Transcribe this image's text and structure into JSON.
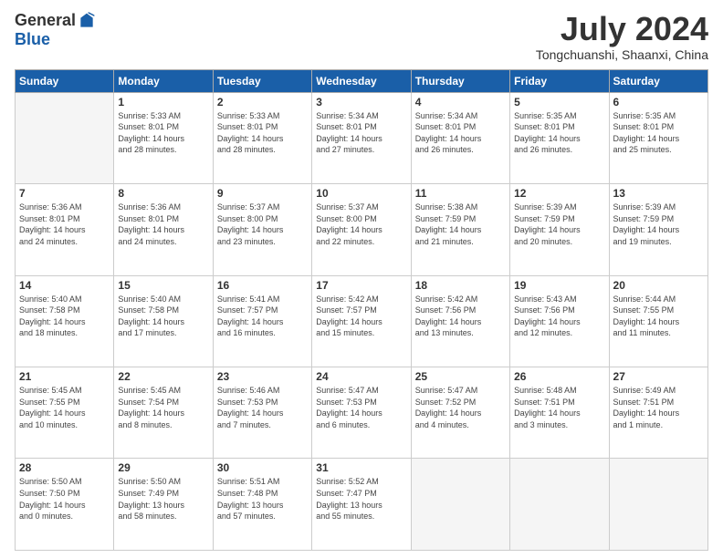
{
  "logo": {
    "general": "General",
    "blue": "Blue"
  },
  "title": "July 2024",
  "location": "Tongchuanshi, Shaanxi, China",
  "headers": [
    "Sunday",
    "Monday",
    "Tuesday",
    "Wednesday",
    "Thursday",
    "Friday",
    "Saturday"
  ],
  "weeks": [
    [
      {
        "day": "",
        "info": ""
      },
      {
        "day": "1",
        "info": "Sunrise: 5:33 AM\nSunset: 8:01 PM\nDaylight: 14 hours\nand 28 minutes."
      },
      {
        "day": "2",
        "info": "Sunrise: 5:33 AM\nSunset: 8:01 PM\nDaylight: 14 hours\nand 28 minutes."
      },
      {
        "day": "3",
        "info": "Sunrise: 5:34 AM\nSunset: 8:01 PM\nDaylight: 14 hours\nand 27 minutes."
      },
      {
        "day": "4",
        "info": "Sunrise: 5:34 AM\nSunset: 8:01 PM\nDaylight: 14 hours\nand 26 minutes."
      },
      {
        "day": "5",
        "info": "Sunrise: 5:35 AM\nSunset: 8:01 PM\nDaylight: 14 hours\nand 26 minutes."
      },
      {
        "day": "6",
        "info": "Sunrise: 5:35 AM\nSunset: 8:01 PM\nDaylight: 14 hours\nand 25 minutes."
      }
    ],
    [
      {
        "day": "7",
        "info": "Sunrise: 5:36 AM\nSunset: 8:01 PM\nDaylight: 14 hours\nand 24 minutes."
      },
      {
        "day": "8",
        "info": "Sunrise: 5:36 AM\nSunset: 8:01 PM\nDaylight: 14 hours\nand 24 minutes."
      },
      {
        "day": "9",
        "info": "Sunrise: 5:37 AM\nSunset: 8:00 PM\nDaylight: 14 hours\nand 23 minutes."
      },
      {
        "day": "10",
        "info": "Sunrise: 5:37 AM\nSunset: 8:00 PM\nDaylight: 14 hours\nand 22 minutes."
      },
      {
        "day": "11",
        "info": "Sunrise: 5:38 AM\nSunset: 7:59 PM\nDaylight: 14 hours\nand 21 minutes."
      },
      {
        "day": "12",
        "info": "Sunrise: 5:39 AM\nSunset: 7:59 PM\nDaylight: 14 hours\nand 20 minutes."
      },
      {
        "day": "13",
        "info": "Sunrise: 5:39 AM\nSunset: 7:59 PM\nDaylight: 14 hours\nand 19 minutes."
      }
    ],
    [
      {
        "day": "14",
        "info": "Sunrise: 5:40 AM\nSunset: 7:58 PM\nDaylight: 14 hours\nand 18 minutes."
      },
      {
        "day": "15",
        "info": "Sunrise: 5:40 AM\nSunset: 7:58 PM\nDaylight: 14 hours\nand 17 minutes."
      },
      {
        "day": "16",
        "info": "Sunrise: 5:41 AM\nSunset: 7:57 PM\nDaylight: 14 hours\nand 16 minutes."
      },
      {
        "day": "17",
        "info": "Sunrise: 5:42 AM\nSunset: 7:57 PM\nDaylight: 14 hours\nand 15 minutes."
      },
      {
        "day": "18",
        "info": "Sunrise: 5:42 AM\nSunset: 7:56 PM\nDaylight: 14 hours\nand 13 minutes."
      },
      {
        "day": "19",
        "info": "Sunrise: 5:43 AM\nSunset: 7:56 PM\nDaylight: 14 hours\nand 12 minutes."
      },
      {
        "day": "20",
        "info": "Sunrise: 5:44 AM\nSunset: 7:55 PM\nDaylight: 14 hours\nand 11 minutes."
      }
    ],
    [
      {
        "day": "21",
        "info": "Sunrise: 5:45 AM\nSunset: 7:55 PM\nDaylight: 14 hours\nand 10 minutes."
      },
      {
        "day": "22",
        "info": "Sunrise: 5:45 AM\nSunset: 7:54 PM\nDaylight: 14 hours\nand 8 minutes."
      },
      {
        "day": "23",
        "info": "Sunrise: 5:46 AM\nSunset: 7:53 PM\nDaylight: 14 hours\nand 7 minutes."
      },
      {
        "day": "24",
        "info": "Sunrise: 5:47 AM\nSunset: 7:53 PM\nDaylight: 14 hours\nand 6 minutes."
      },
      {
        "day": "25",
        "info": "Sunrise: 5:47 AM\nSunset: 7:52 PM\nDaylight: 14 hours\nand 4 minutes."
      },
      {
        "day": "26",
        "info": "Sunrise: 5:48 AM\nSunset: 7:51 PM\nDaylight: 14 hours\nand 3 minutes."
      },
      {
        "day": "27",
        "info": "Sunrise: 5:49 AM\nSunset: 7:51 PM\nDaylight: 14 hours\nand 1 minute."
      }
    ],
    [
      {
        "day": "28",
        "info": "Sunrise: 5:50 AM\nSunset: 7:50 PM\nDaylight: 14 hours\nand 0 minutes."
      },
      {
        "day": "29",
        "info": "Sunrise: 5:50 AM\nSunset: 7:49 PM\nDaylight: 13 hours\nand 58 minutes."
      },
      {
        "day": "30",
        "info": "Sunrise: 5:51 AM\nSunset: 7:48 PM\nDaylight: 13 hours\nand 57 minutes."
      },
      {
        "day": "31",
        "info": "Sunrise: 5:52 AM\nSunset: 7:47 PM\nDaylight: 13 hours\nand 55 minutes."
      },
      {
        "day": "",
        "info": ""
      },
      {
        "day": "",
        "info": ""
      },
      {
        "day": "",
        "info": ""
      }
    ]
  ]
}
